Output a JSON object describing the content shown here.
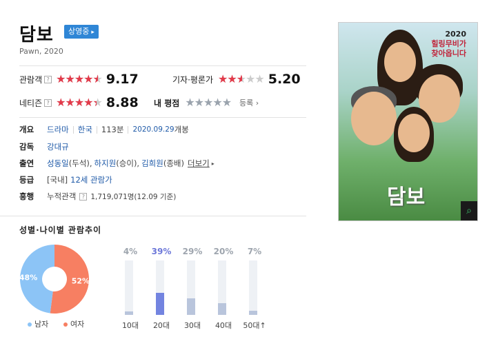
{
  "movie": {
    "title": "담보",
    "badge": "상영중",
    "subtitle": "Pawn, 2020"
  },
  "ratings": {
    "audience": {
      "label": "관람객",
      "score": "9.17",
      "stars": 9.17
    },
    "critic": {
      "label": "기자·평론가",
      "score": "5.20",
      "stars": 5.2
    },
    "netizen": {
      "label": "네티즌",
      "score": "8.88",
      "stars": 8.88
    },
    "mine": {
      "label": "내 평점",
      "register": "등록"
    }
  },
  "info": {
    "overview_label": "개요",
    "genre": "드라마",
    "country": "한국",
    "runtime": "113분",
    "release_date": "2020.09.29",
    "release_suffix": "개봉",
    "director_label": "감독",
    "director": "강대규",
    "cast_label": "출연",
    "cast": [
      {
        "name": "성동일",
        "role": "(두석),"
      },
      {
        "name": "하지원",
        "role": "(승이),"
      },
      {
        "name": "김희원",
        "role": "(종배)"
      }
    ],
    "more": "더보기",
    "grade_label": "등급",
    "grade_prefix": "[국내]",
    "grade": "12세 관람가",
    "box_label": "흥행",
    "box_prefix": "누적관객",
    "box_value": "1,719,071명(12.09 기준)"
  },
  "poster": {
    "tagline_1": "2020",
    "tagline_2": "힐링무비가",
    "tagline_3": "찾아옵니다",
    "title": "담보"
  },
  "audience_trend": {
    "title": "성별·나이별 관람추이",
    "gender": [
      {
        "name": "남자",
        "pct": "48%",
        "value": 48,
        "color": "#8cc4f6"
      },
      {
        "name": "여자",
        "pct": "52%",
        "value": 52,
        "color": "#f77f62"
      }
    ],
    "ages": [
      {
        "label": "10대",
        "pct": "4%",
        "value": 4
      },
      {
        "label": "20대",
        "pct": "39%",
        "value": 39,
        "highlight": true
      },
      {
        "label": "30대",
        "pct": "29%",
        "value": 29
      },
      {
        "label": "40대",
        "pct": "20%",
        "value": 20
      },
      {
        "label": "50대↑",
        "pct": "7%",
        "value": 7
      }
    ]
  }
}
